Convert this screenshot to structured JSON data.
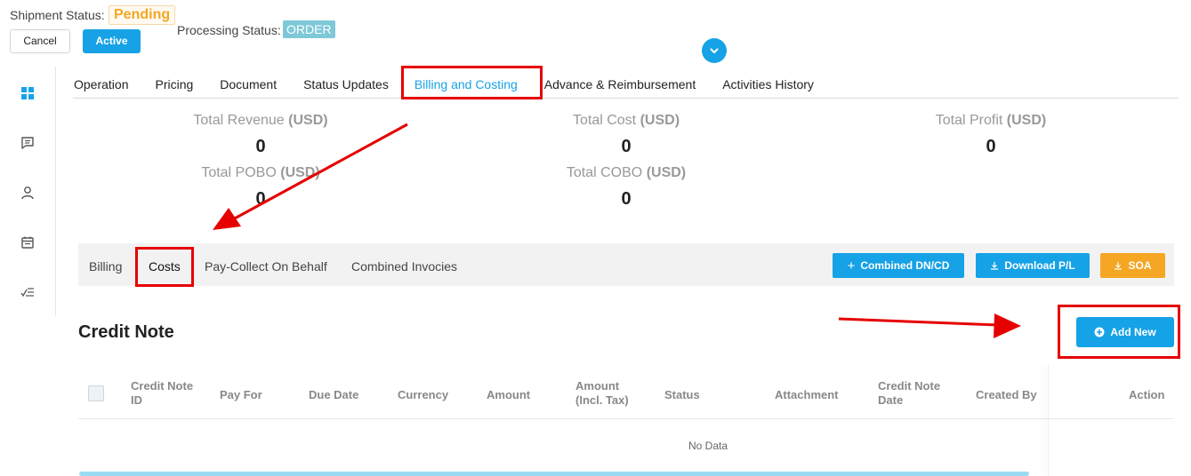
{
  "header": {
    "shipment_status_label": "Shipment Status:",
    "shipment_status_value": "Pending",
    "cancel_label": "Cancel",
    "active_label": "Active",
    "processing_status_label": "Processing Status:",
    "processing_status_value": "ORDER"
  },
  "tabs": [
    {
      "label": "Operation"
    },
    {
      "label": "Pricing"
    },
    {
      "label": "Document"
    },
    {
      "label": "Status Updates"
    },
    {
      "label": "Billing and Costing"
    },
    {
      "label": "Advance & Reimbursement"
    },
    {
      "label": "Activities History"
    }
  ],
  "totals": {
    "revenue_label": "Total Revenue",
    "revenue_unit": "(USD)",
    "revenue_value": "0",
    "cost_label": "Total Cost",
    "cost_unit": "(USD)",
    "cost_value": "0",
    "profit_label": "Total Profit",
    "profit_unit": "(USD)",
    "profit_value": "0",
    "pobo_label": "Total POBO",
    "pobo_unit": "(USD)",
    "pobo_value": "0",
    "cobo_label": "Total COBO",
    "cobo_unit": "(USD)",
    "cobo_value": "0"
  },
  "subtabs": [
    {
      "label": "Billing"
    },
    {
      "label": "Costs"
    },
    {
      "label": "Pay-Collect On Behalf"
    },
    {
      "label": "Combined Invocies"
    }
  ],
  "actions": {
    "combined_label": "Combined DN/CD",
    "download_label": "Download P/L",
    "soa_label": "SOA"
  },
  "credit_note": {
    "title": "Credit Note",
    "add_new_label": "Add New",
    "columns": {
      "id_line1": "Credit Note",
      "id_line2": "ID",
      "pay_for": "Pay For",
      "due_date": "Due Date",
      "currency": "Currency",
      "amount": "Amount",
      "amount_tax_line1": "Amount",
      "amount_tax_line2": "(Incl. Tax)",
      "status": "Status",
      "attachment": "Attachment",
      "date_line1": "Credit Note",
      "date_line2": "Date",
      "created_by": "Created By",
      "action": "Action"
    },
    "empty_text": "No Data"
  },
  "colors": {
    "accent": "#17a2e6",
    "warning": "#f5a623",
    "annotation": "#e60000"
  }
}
